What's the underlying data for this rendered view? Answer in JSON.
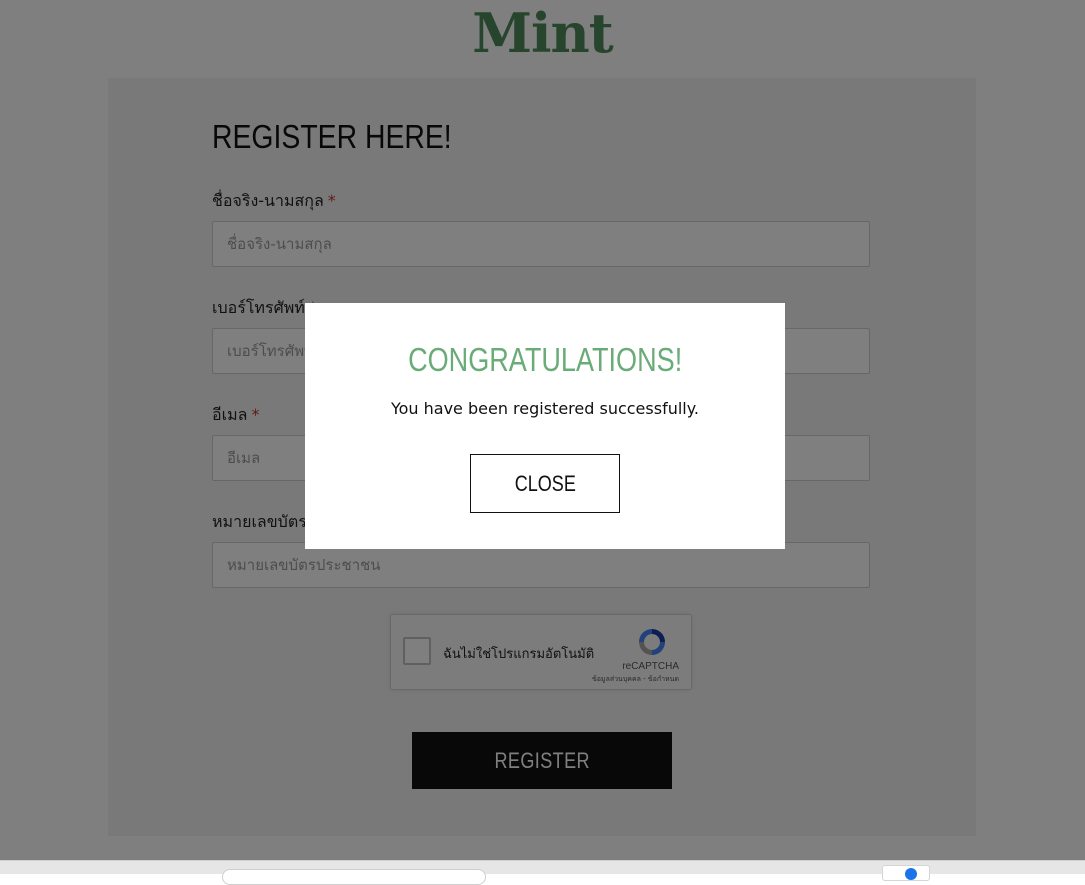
{
  "brand": {
    "logo_text": "Mint",
    "color": "#4d8a59"
  },
  "form": {
    "title": "REGISTER HERE!",
    "fields": [
      {
        "label": "ชื่อจริง-นามสกุล",
        "required_mark": "*",
        "placeholder": "ชื่อจริง-นามสกุล",
        "value": ""
      },
      {
        "label": "เบอร์โทรศัพท์",
        "required_mark": "*",
        "placeholder": "เบอร์โทรศัพท์",
        "value": ""
      },
      {
        "label": "อีเมล",
        "required_mark": "*",
        "placeholder": "อีเมล",
        "value": ""
      },
      {
        "label": "หมายเลขบัตรประชาชน",
        "required_mark": "*",
        "placeholder": "หมายเลขบัตรประชาชน",
        "value": ""
      }
    ],
    "recaptcha": {
      "label": "ฉันไม่ใช่โปรแกรมอัตโนมัติ",
      "brand": "reCAPTCHA",
      "links": "ข้อมูลส่วนบุคคล - ข้อกำหนด",
      "checked": false
    },
    "submit_label": "REGISTER"
  },
  "modal": {
    "title": "CONGRATULATIONS!",
    "message": "You have been registered successfully.",
    "close_label": "CLOSE",
    "title_color": "#6aac78"
  },
  "colors": {
    "required": "#c0392b",
    "button_bg": "#111111"
  }
}
